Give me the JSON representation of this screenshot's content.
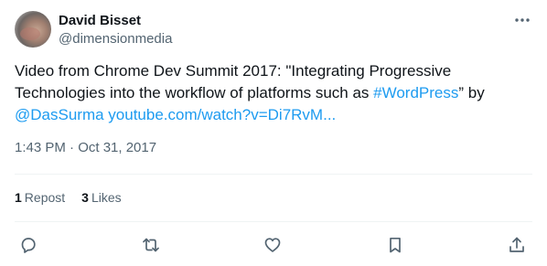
{
  "author": {
    "display_name": "David Bisset",
    "handle": "@dimensionmedia"
  },
  "tweet": {
    "text_before": "Video from Chrome Dev Summit 2017: \"Integrating Progressive Technologies into the workflow of platforms such as ",
    "hashtag": "#WordPress",
    "text_middle": "” by ",
    "mention": "@DasSurma",
    "space": " ",
    "link": "youtube.com/watch?v=Di7RvM..."
  },
  "timestamp": "1:43 PM · Oct 31, 2017",
  "stats": {
    "reposts_count": "1",
    "reposts_label": "Repost",
    "likes_count": "3",
    "likes_label": "Likes"
  },
  "icons": {
    "more": "more-horizontal-icon",
    "reply": "reply-icon",
    "repost": "repost-icon",
    "like": "like-icon",
    "bookmark": "bookmark-icon",
    "share": "share-icon"
  },
  "colors": {
    "link": "#1d9bf0",
    "text_primary": "#0f1419",
    "text_secondary": "#536471",
    "divider": "#eff3f4"
  }
}
